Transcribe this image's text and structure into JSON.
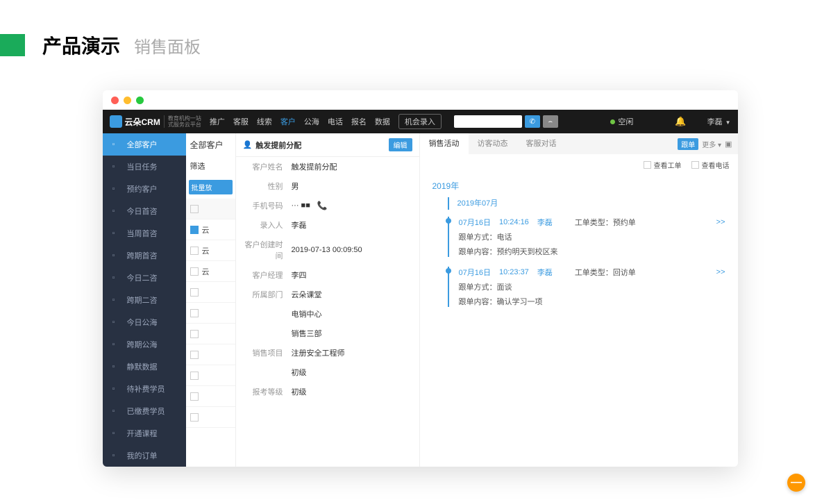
{
  "header": {
    "title": "产品演示",
    "subtitle": "销售面板"
  },
  "topbar": {
    "brand": "云朵CRM",
    "brand_tag1": "教育机构一站",
    "brand_tag2": "式服务云平台",
    "nav": [
      "推广",
      "客服",
      "线索",
      "客户",
      "公海",
      "电话",
      "报名",
      "数据"
    ],
    "active_nav": "客户",
    "entry_btn": "机会录入",
    "status": "空闲",
    "user": "李磊"
  },
  "sidebar": {
    "items": [
      "全部客户",
      "当日任务",
      "预约客户",
      "今日首咨",
      "当周首咨",
      "跨期首咨",
      "今日二咨",
      "跨期二咨",
      "今日公海",
      "跨期公海",
      "静默数据",
      "待补费学员",
      "已缴费学员",
      "开通课程",
      "我的订单"
    ],
    "active": "全部客户"
  },
  "mid": {
    "head": "全部客户",
    "filter": "筛选",
    "batch": "批量放",
    "rows": [
      "云",
      "云",
      "云",
      "",
      "",
      "",
      "",
      "",
      "",
      ""
    ]
  },
  "detail": {
    "title": "触发提前分配",
    "edit": "编辑",
    "fields": [
      {
        "label": "客户姓名",
        "value": "触发提前分配"
      },
      {
        "label": "性别",
        "value": "男"
      },
      {
        "label": "手机号码",
        "value": "···  ■■",
        "phone": true
      },
      {
        "label": "录入人",
        "value": "李磊"
      },
      {
        "label": "客户创建时间",
        "value": "2019-07-13 00:09:50"
      },
      {
        "label": "客户经理",
        "value": "李四"
      },
      {
        "label": "所属部门",
        "value": "云朵课堂"
      },
      {
        "label": "",
        "value": "电销中心"
      },
      {
        "label": "",
        "value": "销售三部"
      },
      {
        "label": "销售项目",
        "value": "注册安全工程师"
      },
      {
        "label": "",
        "value": "初级"
      },
      {
        "label": "报考等级",
        "value": "初级"
      }
    ]
  },
  "activity": {
    "tabs": [
      "销售活动",
      "访客动态",
      "客服对话"
    ],
    "active_tab": "销售活动",
    "tag": "跟单",
    "more": "更多 ▾",
    "view_ticket": "查看工单",
    "view_call": "查看电话",
    "year": "2019年",
    "month": "2019年07月",
    "entries": [
      {
        "date": "07月16日",
        "time": "10:24:16",
        "user": "李磊",
        "type_label": "工单类型：",
        "type": "预约单",
        "method_label": "跟单方式：",
        "method": "电话",
        "content_label": "跟单内容：",
        "content": "预约明天到校区来",
        "expand": ">>"
      },
      {
        "date": "07月16日",
        "time": "10:23:37",
        "user": "李磊",
        "type_label": "工单类型：",
        "type": "回访单",
        "method_label": "跟单方式：",
        "method": "面谈",
        "content_label": "跟单内容：",
        "content": "确认学习一项",
        "expand": ">>"
      }
    ]
  }
}
